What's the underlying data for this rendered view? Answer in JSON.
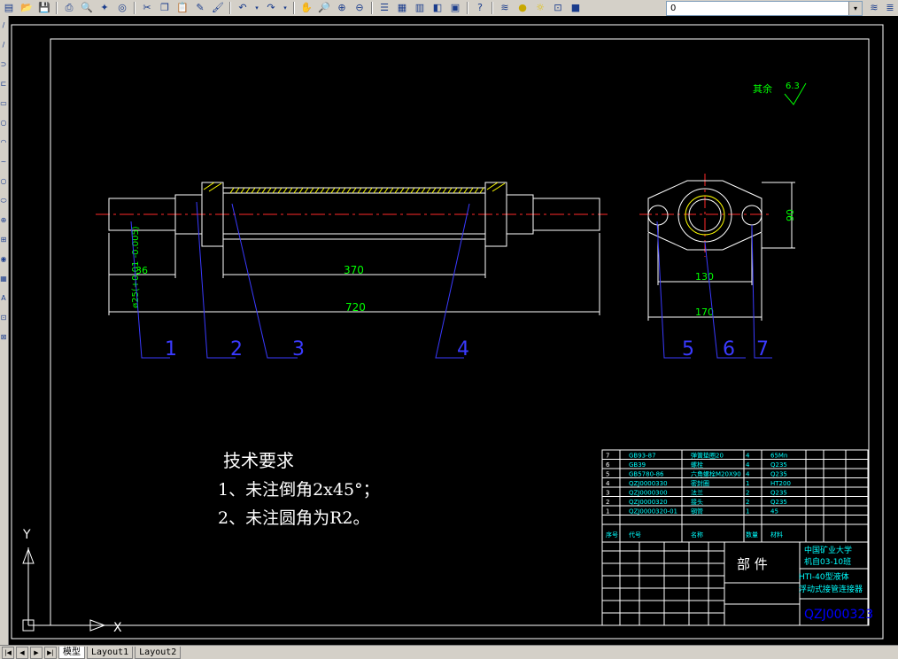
{
  "toolbar": {
    "icons": [
      "new-icon",
      "open-icon",
      "save-icon",
      "print-icon",
      "preview-icon",
      "publish-icon",
      "plot-icon",
      "cut-icon",
      "copy-icon",
      "paste-icon",
      "match-icon",
      "brush-icon",
      "undo-icon",
      "redo-icon",
      "pan-icon",
      "zoom-realtime-icon",
      "zoom-window-icon",
      "zoom-previous-icon",
      "properties-icon",
      "designcenter-icon",
      "toolpalette-icon",
      "markup-icon",
      "calc-icon",
      "help-icon",
      "layer-icon",
      "bulb-icon",
      "sun-icon",
      "lock-icon",
      "color-icon"
    ],
    "layer_value": "0",
    "layer_dropdown": "▾"
  },
  "left_toolbar": {
    "glyphs": [
      "/",
      "/",
      "⊃",
      "⊏",
      "▭",
      "○",
      "◠",
      "~",
      "○",
      "⬭",
      "⊕",
      "⊞",
      "◉",
      "▦",
      "A",
      "⊡",
      "⊠"
    ]
  },
  "drawing": {
    "roughness_label": "其余",
    "roughness_value": "6.3",
    "dim_len_370": "370",
    "dim_len_720": "720",
    "dim_left_vertical": "ø25(+0.01 -0.005)",
    "dim_left_36": "36",
    "dim_right_130": "130",
    "dim_right_170": "170",
    "dim_right_90": "90",
    "balloons": [
      "1",
      "2",
      "3",
      "4",
      "5",
      "6",
      "7"
    ],
    "tech_title": "技术要求",
    "tech_note_1": "1、未注倒角2x45°；",
    "tech_note_2": "2、未注圆角为R2。",
    "ucs_y": "Y",
    "ucs_x": "X"
  },
  "title_block": {
    "rows": [
      {
        "no": "7",
        "code": "GB93-87",
        "name": "弹簧垫圈20",
        "qty": "4",
        "mat": "65Mn"
      },
      {
        "no": "6",
        "code": "GB39",
        "name": "螺栓",
        "qty": "4",
        "mat": "Q235"
      },
      {
        "no": "5",
        "code": "GB5780-86",
        "name": "六角螺栓M20X90",
        "qty": "4",
        "mat": "Q235"
      },
      {
        "no": "4",
        "code": "QZJ0000330",
        "name": "密封圈",
        "qty": "1",
        "mat": "HT200"
      },
      {
        "no": "3",
        "code": "QZJ0000300",
        "name": "法兰",
        "qty": "2",
        "mat": "Q235"
      },
      {
        "no": "2",
        "code": "QZJ0000320",
        "name": "接头",
        "qty": "2",
        "mat": "Q235"
      },
      {
        "no": "1",
        "code": "QZJ0000320-01",
        "name": "钢管",
        "qty": "1",
        "mat": "45"
      }
    ],
    "header": {
      "no": "序号",
      "code": "代号",
      "name": "名称",
      "qty": "数量",
      "mat": "材料"
    },
    "part_title": "部 件",
    "school_1": "中国矿业大学",
    "school_2": "机自03-10班",
    "product_1": "HTI-40型液体",
    "product_2": "浮动式接管连接器",
    "drawing_no": "QZJ000323"
  },
  "bottom": {
    "nav": [
      "|◀",
      "◀",
      "▶",
      "▶|"
    ],
    "tabs": [
      "模型",
      "Layout1",
      "Layout2"
    ]
  }
}
